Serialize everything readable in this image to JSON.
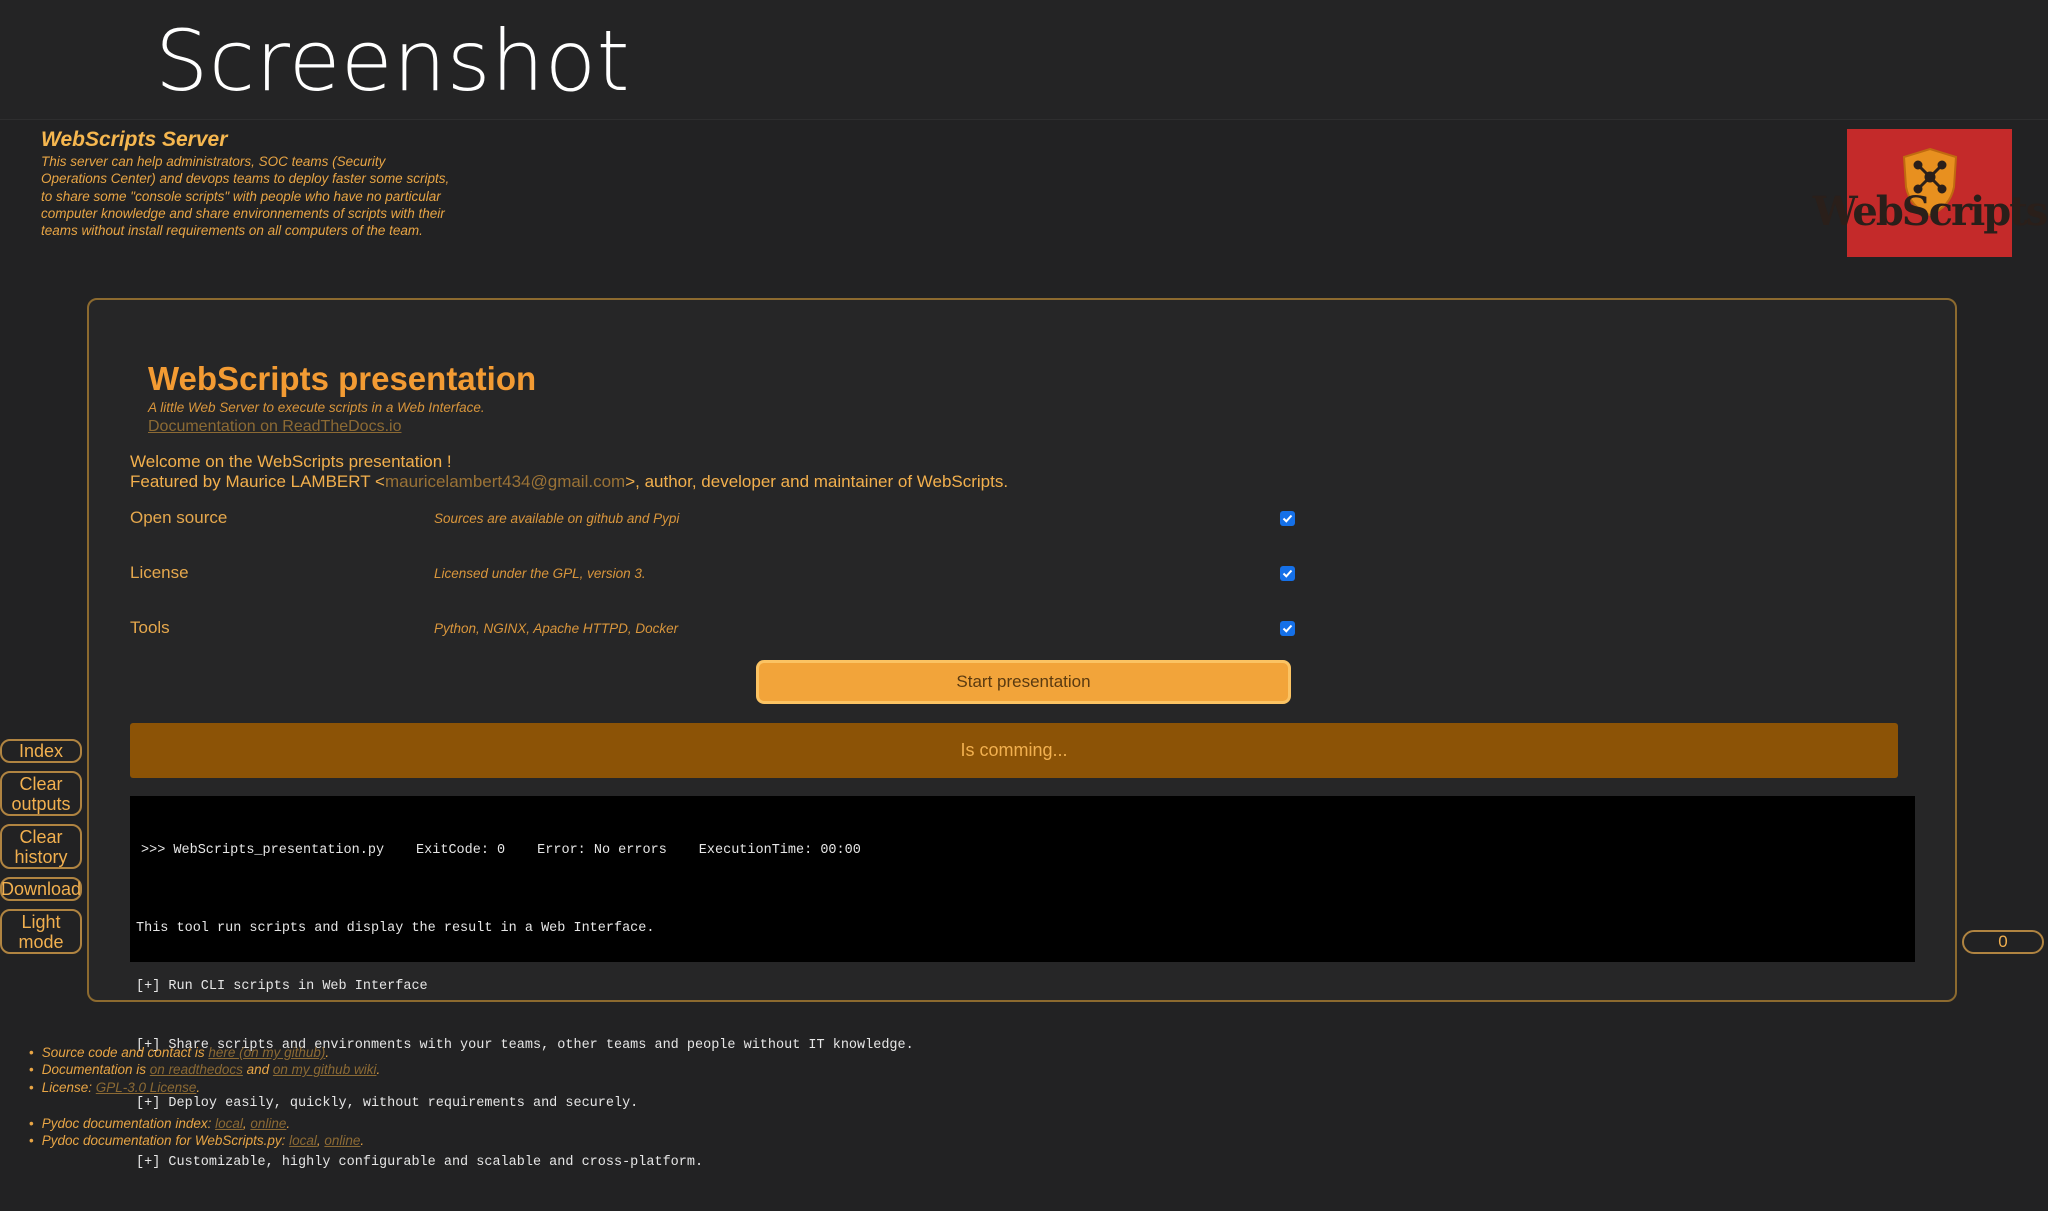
{
  "slide": {
    "title": "Screenshot"
  },
  "header": {
    "server_title": "WebScripts Server",
    "server_description": "This server can help administrators, SOC teams (Security Operations Center) and devops teams to deploy faster some scripts, to share some \"console scripts\" with people who have no particular computer knowledge and share environnements of scripts with their teams without install requirements on all computers of the team.",
    "logo_text": "WebScripts",
    "logo_color": "#c42a2a"
  },
  "script": {
    "title": "WebScripts presentation",
    "description": "A little Web Server to execute scripts in a Web Interface.",
    "doc_link": "Documentation on ReadTheDocs.io",
    "welcome_line1": "Welcome on the WebScripts presentation !",
    "welcome_line2_prefix": "Featured by Maurice LAMBERT <",
    "welcome_email": "mauricelambert434@gmail.com",
    "welcome_line2_suffix": ">, author, developer and maintainer of WebScripts."
  },
  "arguments": [
    {
      "label": "Open source",
      "description": "Sources are available on github and Pypi",
      "checked": true
    },
    {
      "label": "License",
      "description": "Licensed under the GPL, version 3.",
      "checked": true
    },
    {
      "label": "Tools",
      "description": "Python, NGINX, Apache HTTPD, Docker",
      "checked": true
    }
  ],
  "start_button": "Start presentation",
  "progress": {
    "text": "Is comming...",
    "color": "#8c5306"
  },
  "console": {
    "prompt": ">>> WebScripts_presentation.py",
    "exit_code": "ExitCode: 0",
    "error": "Error: No errors",
    "execution_time": "ExecutionTime: 00:00",
    "lines": [
      "This tool run scripts and display the result in a Web Interface.",
      "[+] Run CLI scripts in Web Interface",
      "[+] Share scripts and environments with your teams, other teams and people without IT knowledge.",
      "[+] Deploy easily, quickly, without requirements and securely.",
      "[+] Customizable, highly configurable and scalable and cross-platform."
    ]
  },
  "side_buttons": {
    "index": "Index",
    "clear_outputs": "Clear outputs",
    "clear_history": "Clear history",
    "download": "Download",
    "light_mode": "Light mode"
  },
  "counter": "0",
  "footer": {
    "source_prefix": "Source code and contact is ",
    "source_link": "here (on my github)",
    "source_suffix": ".",
    "doc_prefix": "Documentation is ",
    "doc_link1": "on readthedocs",
    "doc_mid": " and ",
    "doc_link2": "on my github wiki",
    "doc_suffix": ".",
    "license_prefix": "License: ",
    "license_link": "GPL-3.0 License",
    "license_suffix": ".",
    "pydoc_index_prefix": "Pydoc documentation index: ",
    "pydoc_index_local": "local",
    "pydoc_index_sep": ", ",
    "pydoc_index_online": "online",
    "pydoc_index_suffix": ".",
    "pydoc_ws_prefix": "Pydoc documentation for WebScripts.py: ",
    "pydoc_ws_local": "local",
    "pydoc_ws_sep": ", ",
    "pydoc_ws_online": "online",
    "pydoc_ws_suffix": "."
  }
}
